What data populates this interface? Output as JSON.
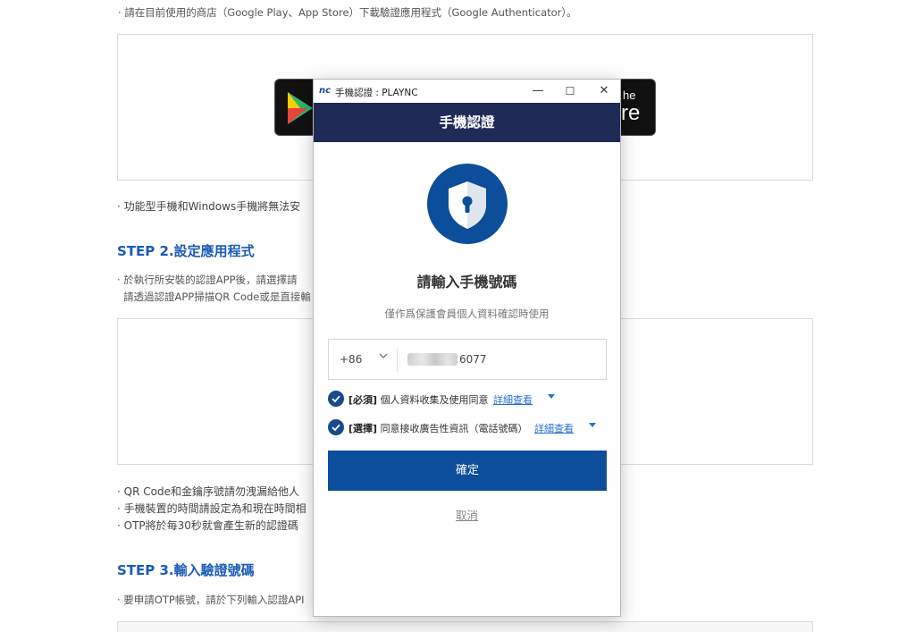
{
  "background": {
    "intro_line": "· 請在目前使用的商店（Google Play、App Store）下載驗證應用程式（Google Authenticator）。",
    "feature_phone_note": "· 功能型手機和Windows手機將無法安",
    "step2_title": "STEP 2.設定應用程式",
    "step2_line1": "· 於執行所安裝的認證APP後，請選擇請",
    "step2_line2": "請透過認證APP掃描QR Code或是直接輸",
    "notes": [
      "· QR Code和金鑰序號請勿洩漏給他人",
      "· 手機裝置的時間請設定為和現在時間相",
      "· OTP將於每30秒就會產生新的認證碼"
    ],
    "step3_title": "STEP 3.輸入驗證號碼",
    "step3_line": "· 要申請OTP帳號，請於下列輸入認證API",
    "appstore_badge_text_top": "he",
    "appstore_badge_text_bottom": "re"
  },
  "popup": {
    "window_logo": "nc",
    "window_title": "手機認證 : PLAYNC",
    "controls": {
      "minimize": "—",
      "maximize": "☐",
      "close": "✕"
    },
    "header_title": "手機認證",
    "icon": "shield-lock-icon",
    "heading": "請輸入手機號碼",
    "subheading": "僅作爲保護會員個人資料確認時使用",
    "country_code": "+86",
    "phone_suffix": "6077",
    "agreements": [
      {
        "tag": "[必須]",
        "text": "個人資料收集及使用同意",
        "link": "詳細查看"
      },
      {
        "tag": "[選擇]",
        "text": "同意接收廣告性資訊（電話號碼）",
        "link": "詳細查看"
      }
    ],
    "confirm_label": "確定",
    "cancel_label": "取消"
  },
  "colors": {
    "header_bg": "#1f2b56",
    "primary_button": "#0c4e9b",
    "step_title": "#1a5bb8",
    "link": "#2a6fd1"
  }
}
